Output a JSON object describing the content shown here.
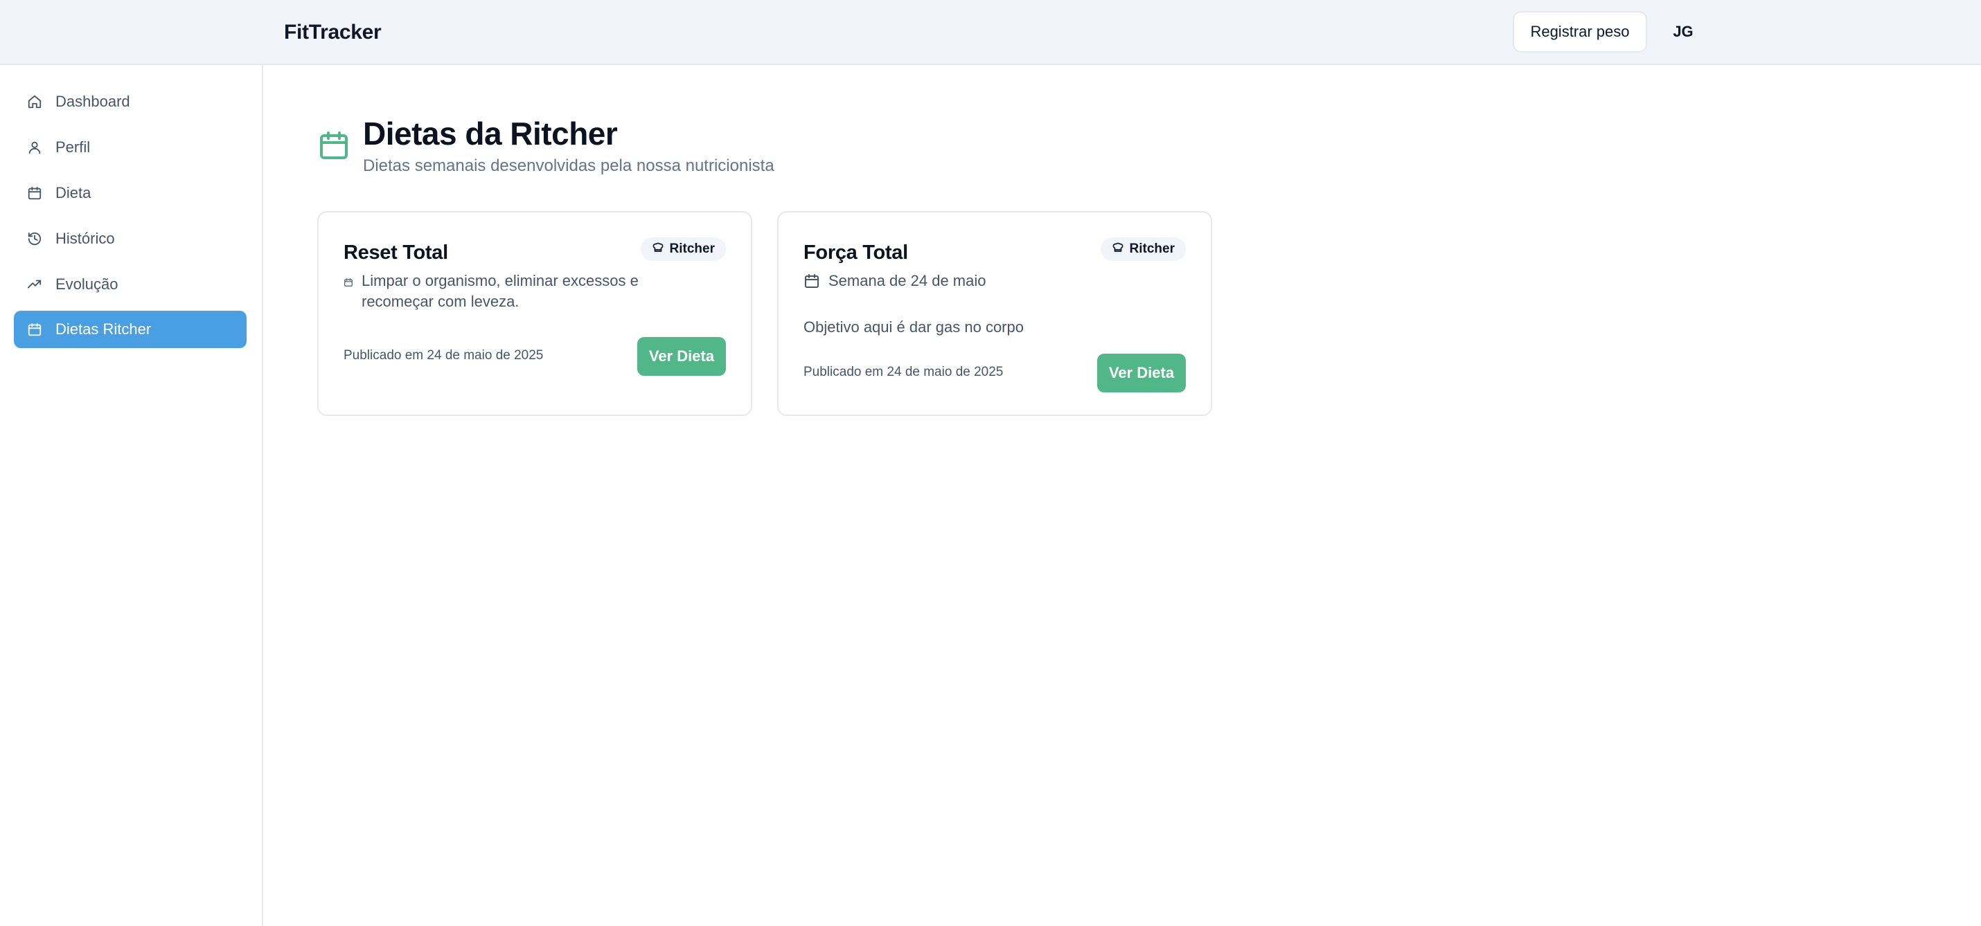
{
  "app": {
    "brand": "FitTracker"
  },
  "header": {
    "register_label": "Registrar peso",
    "avatar_initials": "JG"
  },
  "sidebar": {
    "items": [
      {
        "label": "Dashboard",
        "icon": "home-icon",
        "active": false
      },
      {
        "label": "Perfil",
        "icon": "user-icon",
        "active": false
      },
      {
        "label": "Dieta",
        "icon": "calendar-icon",
        "active": false
      },
      {
        "label": "Histórico",
        "icon": "history-icon",
        "active": false
      },
      {
        "label": "Evolução",
        "icon": "trending-up-icon",
        "active": false
      },
      {
        "label": "Dietas Ritcher",
        "icon": "calendar-icon",
        "active": true
      }
    ]
  },
  "page": {
    "title": "Dietas da Ritcher",
    "subtitle": "Dietas semanais desenvolvidas pela nossa nutricionista",
    "icon": "calendar-icon"
  },
  "cards": [
    {
      "title": "Reset Total",
      "badge": "Ritcher",
      "meta": "Limpar o organismo, eliminar excessos e recomeçar com leveza.",
      "description": "",
      "published": "Publicado em 24 de maio de 2025",
      "button": "Ver Dieta"
    },
    {
      "title": "Força Total",
      "badge": "Ritcher",
      "meta": "Semana de 24 de maio",
      "description": "Objetivo aqui é dar gas no corpo",
      "published": "Publicado em 24 de maio de 2025",
      "button": "Ver Dieta"
    }
  ],
  "colors": {
    "accent_blue": "#4a9fe2",
    "accent_green": "#52b788",
    "header_bg": "#f1f5f9"
  }
}
